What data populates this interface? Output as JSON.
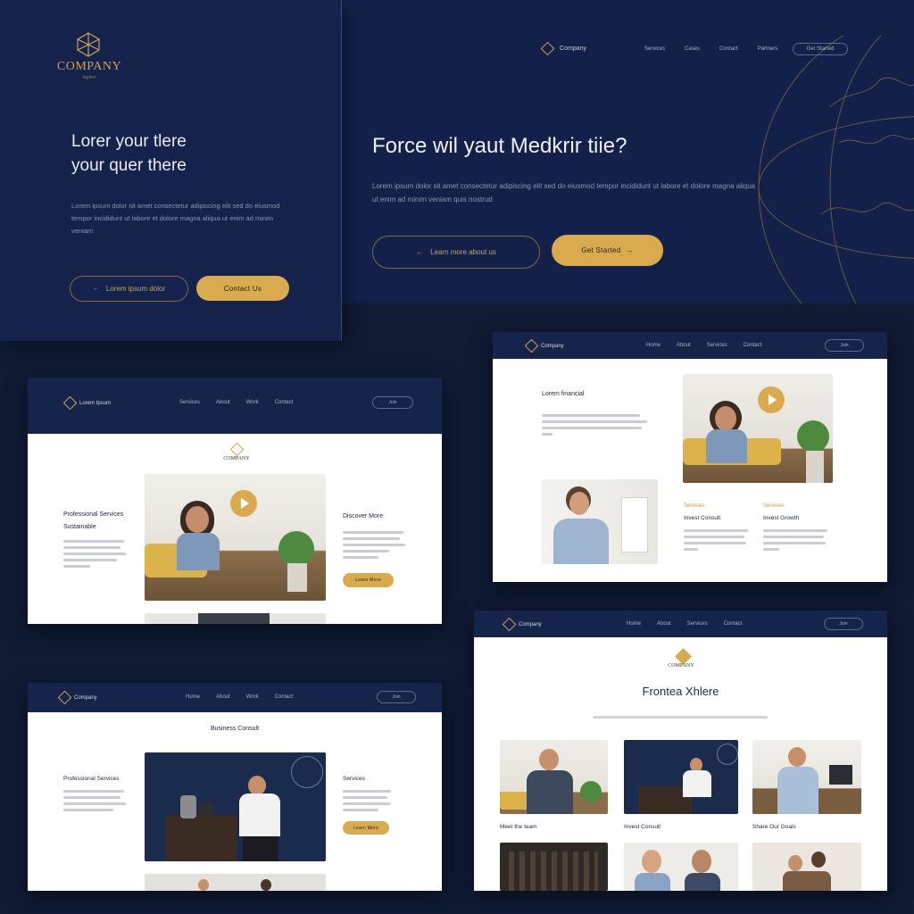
{
  "hero": {
    "logo_name": "COMPANY",
    "logo_sub": "tagline",
    "nav_brand": "Company",
    "nav_links": [
      "Services",
      "Cases",
      "Contact",
      "Partners"
    ],
    "nav_button": "Get Started",
    "left_heading_1": "Lorer your tlere",
    "left_heading_2": "your quer there",
    "left_body": "Lorem ipsum dolor sit amet consectetur adipiscing elit sed do eiusmod tempor incididunt ut labore et dolore magna aliqua ut enim ad minim veniam",
    "left_ghost_button": "Lorem ipsum dolor",
    "left_gold_button": "Contact Us",
    "right_heading": "Force wil yaut Medkrir tiie?",
    "right_body": "Lorem ipsum dolor sit amet consectetur adipiscing elit sed do eiusmod tempor incididunt ut labore et dolore magna aliqua ut enim ad minim veniam quis nostrud",
    "right_ghost_button": "Learn more about us",
    "right_gold_button": "Get Started"
  },
  "card_a": {
    "brand": "Lorem Ipsum",
    "nav_links": [
      "Services",
      "About",
      "Work",
      "Contact"
    ],
    "nav_button": "Join",
    "logo_name": "COMPANY",
    "left_title_1": "Professional Services",
    "left_title_2": "Sustainable",
    "right_title": "Discover More",
    "button": "Learn More"
  },
  "card_b": {
    "brand": "Company",
    "nav_links": [
      "Home",
      "About",
      "Services",
      "Contact"
    ],
    "nav_button": "Join",
    "title": "Lorem financial",
    "col1_label": "Services",
    "col1_title": "Invest Consult",
    "col2_label": "Services",
    "col2_title": "Invest Growth"
  },
  "card_c": {
    "brand": "Company",
    "nav_links": [
      "Home",
      "About",
      "Work",
      "Contact"
    ],
    "nav_button": "Join",
    "title": "Business Consult",
    "left_title": "Professional Services",
    "right_title": "Services",
    "button": "Learn More"
  },
  "card_d": {
    "brand": "Company",
    "nav_links": [
      "Home",
      "About",
      "Services",
      "Contact"
    ],
    "nav_button": "Join",
    "logo_name": "COMPANY",
    "title": "Frontea Xhlere",
    "captions": [
      "Meet the team",
      "Invest Consult",
      "Share Our Goals"
    ]
  },
  "colors": {
    "navy": "#0f1a33",
    "navy_header": "#16234a",
    "gold": "#d9ab4e"
  }
}
